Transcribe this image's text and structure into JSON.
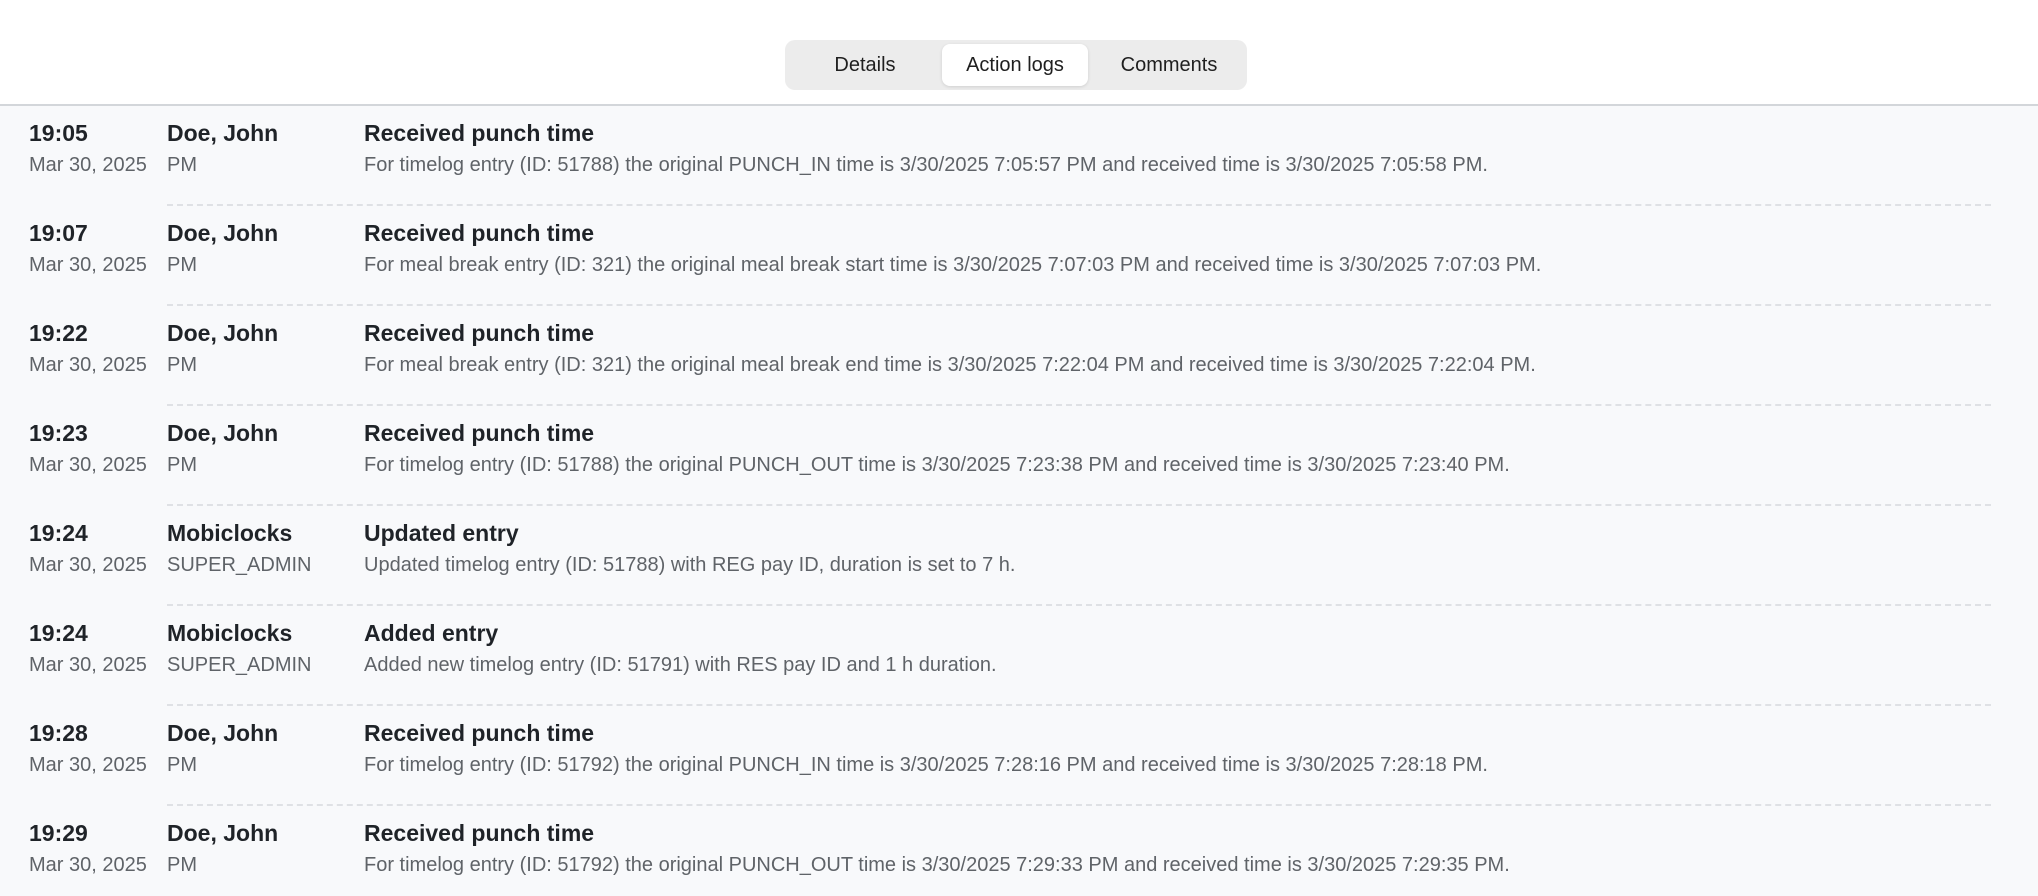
{
  "tabs": [
    {
      "label": "Details",
      "active": false
    },
    {
      "label": "Action logs",
      "active": true
    },
    {
      "label": "Comments",
      "active": false
    }
  ],
  "logs": [
    {
      "time": "19:05",
      "date": "Mar 30, 2025",
      "user": "Doe, John",
      "role": "PM",
      "title": "Received punch time",
      "description": "For timelog entry (ID: 51788) the original PUNCH_IN time is 3/30/2025 7:05:57 PM and received time is 3/30/2025 7:05:58 PM."
    },
    {
      "time": "19:07",
      "date": "Mar 30, 2025",
      "user": "Doe, John",
      "role": "PM",
      "title": "Received punch time",
      "description": "For meal break entry (ID: 321) the original meal break start time is 3/30/2025 7:07:03 PM and received time is 3/30/2025 7:07:03 PM."
    },
    {
      "time": "19:22",
      "date": "Mar 30, 2025",
      "user": "Doe, John",
      "role": "PM",
      "title": "Received punch time",
      "description": "For meal break entry (ID: 321) the original meal break end time is 3/30/2025 7:22:04 PM and received time is 3/30/2025 7:22:04 PM."
    },
    {
      "time": "19:23",
      "date": "Mar 30, 2025",
      "user": "Doe, John",
      "role": "PM",
      "title": "Received punch time",
      "description": "For timelog entry (ID: 51788) the original PUNCH_OUT time is 3/30/2025 7:23:38 PM and received time is 3/30/2025 7:23:40 PM."
    },
    {
      "time": "19:24",
      "date": "Mar 30, 2025",
      "user": "Mobiclocks",
      "role": "SUPER_ADMIN",
      "title": "Updated entry",
      "description": "Updated timelog entry (ID: 51788) with REG pay ID, duration is set to 7 h."
    },
    {
      "time": "19:24",
      "date": "Mar 30, 2025",
      "user": "Mobiclocks",
      "role": "SUPER_ADMIN",
      "title": "Added entry",
      "description": "Added new timelog entry (ID: 51791) with RES pay ID and 1 h duration."
    },
    {
      "time": "19:28",
      "date": "Mar 30, 2025",
      "user": "Doe, John",
      "role": "PM",
      "title": "Received punch time",
      "description": "For timelog entry (ID: 51792) the original PUNCH_IN time is 3/30/2025 7:28:16 PM and received time is 3/30/2025 7:28:18 PM."
    },
    {
      "time": "19:29",
      "date": "Mar 30, 2025",
      "user": "Doe, John",
      "role": "PM",
      "title": "Received punch time",
      "description": "For timelog entry (ID: 51792) the original PUNCH_OUT time is 3/30/2025 7:29:33 PM and received time is 3/30/2025 7:29:35 PM."
    }
  ]
}
